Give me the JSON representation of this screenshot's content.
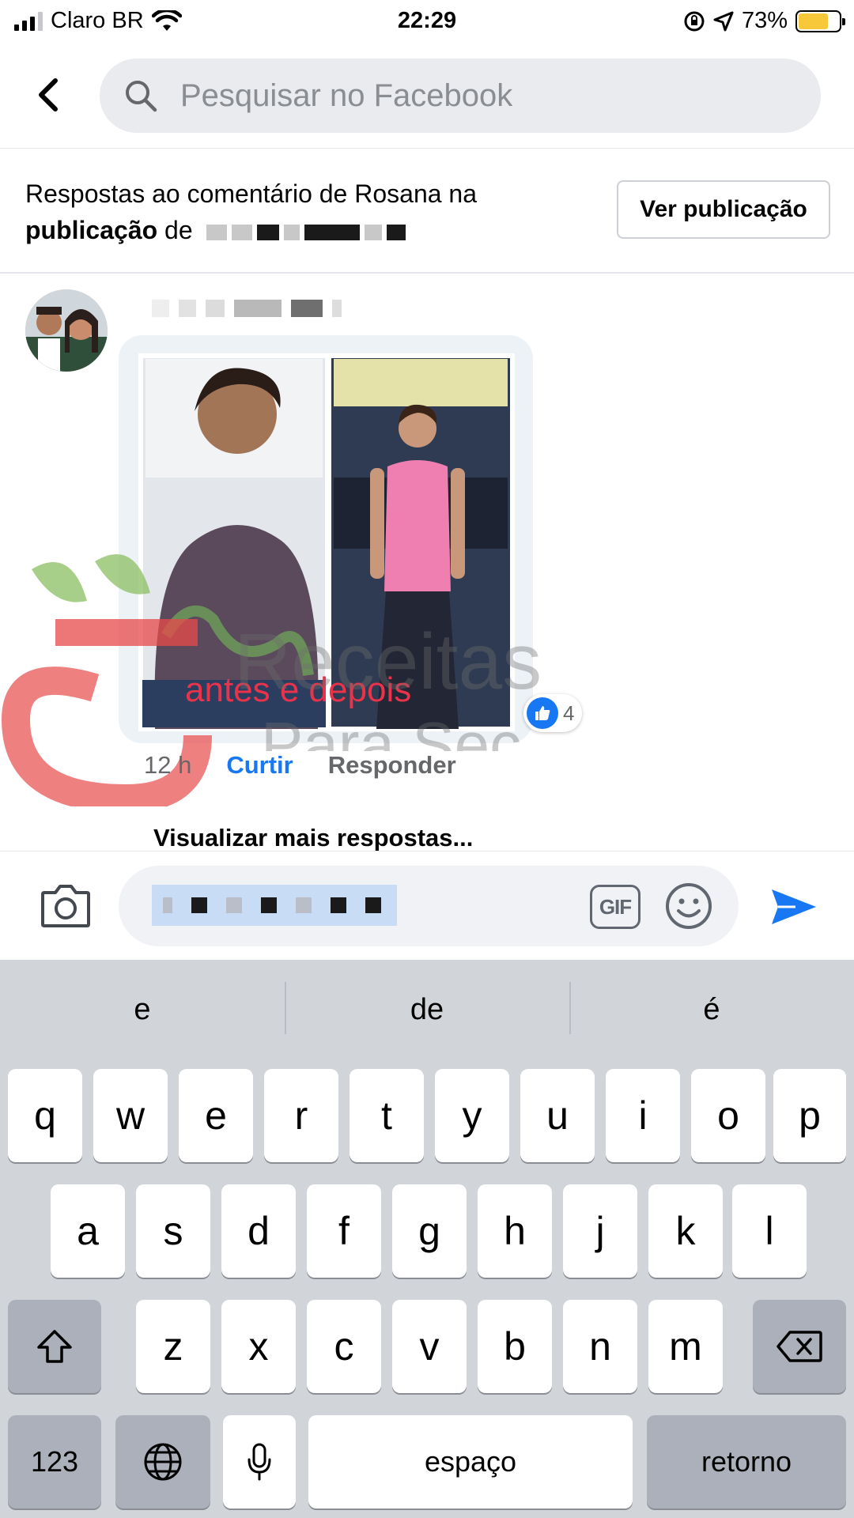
{
  "status_bar": {
    "carrier": "Claro BR",
    "time": "22:29",
    "battery": "73%",
    "battery_level": 0.73
  },
  "search": {
    "placeholder": "Pesquisar no Facebook"
  },
  "context": {
    "line1": "Respostas ao comentário de Rosana na",
    "bold": "publicação",
    "de": " de ",
    "button": "Ver publicação"
  },
  "comment": {
    "image_caption": "antes e depois",
    "reaction_count": "4",
    "time": "12 h",
    "like": "Curtir",
    "reply": "Responder",
    "more_replies": "Visualizar mais respostas..."
  },
  "watermark": {
    "line1": "Receitas",
    "line2": "Para Sec"
  },
  "composer": {
    "gif": "GIF"
  },
  "keyboard": {
    "suggestions": [
      "e",
      "de",
      "é"
    ],
    "row1": [
      "q",
      "w",
      "e",
      "r",
      "t",
      "y",
      "u",
      "i",
      "o",
      "p"
    ],
    "row2": [
      "a",
      "s",
      "d",
      "f",
      "g",
      "h",
      "j",
      "k",
      "l"
    ],
    "row3": [
      "z",
      "x",
      "c",
      "v",
      "b",
      "n",
      "m"
    ],
    "numbers": "123",
    "space": "espaço",
    "return": "retorno"
  },
  "colors": {
    "accent": "#1877f2",
    "keyboard_bg": "#d1d4d9",
    "search_bg": "#e9ebee"
  }
}
